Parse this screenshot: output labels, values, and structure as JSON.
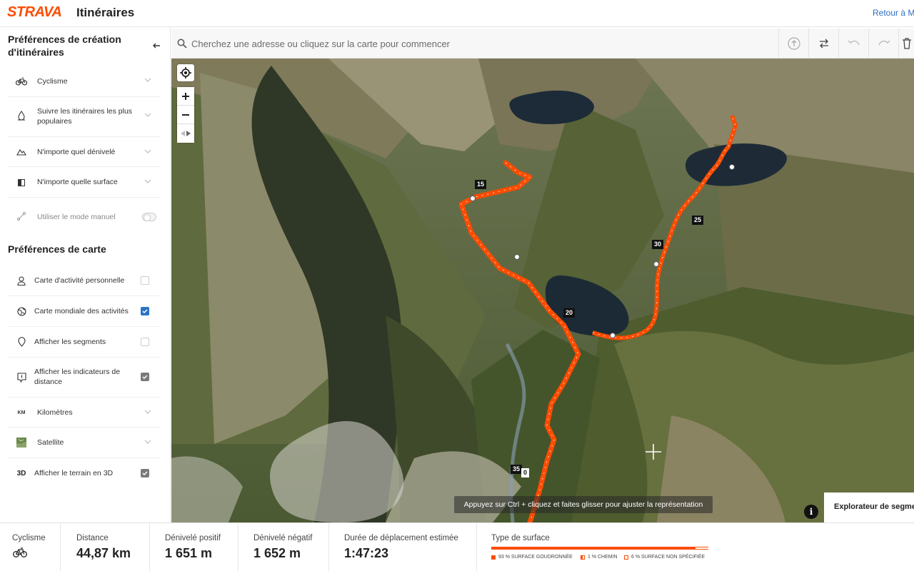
{
  "header": {
    "logo": "STRAVA",
    "title": "Itinéraires",
    "back_link": "Retour à Mo"
  },
  "sidebar": {
    "route_prefs_title": "Préférences de création d'itinéraires",
    "route_prefs": [
      {
        "label": "Cyclisme",
        "icon": "bike-icon"
      },
      {
        "label": "Suivre les itinéraires les plus populaires",
        "icon": "popularity-icon"
      },
      {
        "label": "N'importe quel dénivelé",
        "icon": "elevation-icon"
      },
      {
        "label": "N'importe quelle surface",
        "icon": "surface-icon"
      }
    ],
    "manual_mode_label": "Utiliser le mode manuel",
    "map_prefs_title": "Préférences de carte",
    "map_prefs": [
      {
        "label": "Carte d'activité personnelle",
        "icon": "person-icon",
        "checked": false
      },
      {
        "label": "Carte mondiale des activités",
        "icon": "globe-icon",
        "checked": true
      },
      {
        "label": "Afficher les segments",
        "icon": "segment-pin-icon",
        "checked": false
      },
      {
        "label": "Afficher les indicateurs de distance",
        "icon": "distance-marker-icon",
        "checked": true
      }
    ],
    "units": {
      "label": "Kilomètres",
      "icon_text": "KM"
    },
    "map_type": {
      "label": "Satellite"
    },
    "terrain": {
      "label": "Afficher le terrain en 3D",
      "icon_text": "3D",
      "checked": true
    }
  },
  "search": {
    "placeholder": "Cherchez une adresse ou cliquez sur la carte pour commencer"
  },
  "toolbar": {
    "icons": [
      "upload-icon",
      "swap-icon",
      "undo-icon",
      "redo-icon",
      "trash-icon"
    ]
  },
  "map": {
    "km_markers": [
      "15",
      "20",
      "25",
      "30",
      "35",
      "0"
    ],
    "hint": "Appuyez sur Ctrl + cliquez et faites glisser pour ajuster la représentation",
    "segment_explorer": "Explorateur de segme",
    "info_label": "i",
    "route_color": "#fc4c02"
  },
  "stats": {
    "sport": {
      "label": "Cyclisme"
    },
    "distance": {
      "label": "Distance",
      "value": "44,87 km"
    },
    "elev_gain": {
      "label": "Dénivelé positif",
      "value": "1 651 m"
    },
    "elev_loss": {
      "label": "Dénivelé négatif",
      "value": "1 652 m"
    },
    "duration": {
      "label": "Durée de déplacement estimée",
      "value": "1:47:23"
    },
    "surface": {
      "label": "Type de surface",
      "legend": [
        {
          "text": "93 % SURFACE GOUDRONNÉE",
          "percent": 93,
          "color": "#fc4c02"
        },
        {
          "text": "1 % CHEMIN",
          "percent": 1,
          "color": "#fc4c02"
        },
        {
          "text": "6 % SURFACE NON SPÉCIFIÉE",
          "percent": 6,
          "color": "#ffffff"
        }
      ]
    }
  }
}
